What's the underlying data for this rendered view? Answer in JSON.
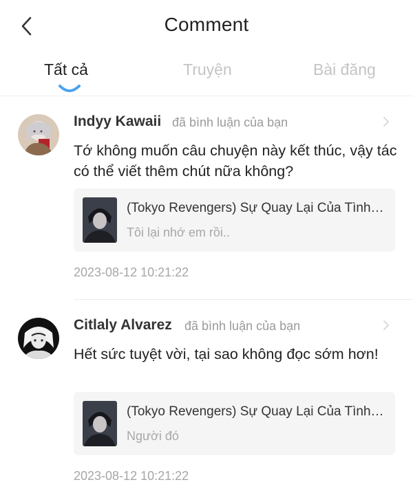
{
  "header": {
    "back_icon": "chevron-left-icon",
    "title": "Comment"
  },
  "tabs": [
    {
      "label": "Tất cả",
      "active": true
    },
    {
      "label": "Truyện",
      "active": false
    },
    {
      "label": "Bài đăng",
      "active": false
    }
  ],
  "comments": [
    {
      "user": "Indyy Kawaii",
      "action": "đã bình luận của bạn",
      "text": "Tớ không muốn câu chuyện này kết thúc, vậy tác có thể viết thêm chút nữa không?",
      "story_title": "(Tokyo Revengers) Sự Quay Lại Của Tình Yêu",
      "story_subtitle": "Tôi lại nhớ em rồi..",
      "time": "2023-08-12 10:21:22"
    },
    {
      "user": "Citlaly Alvarez",
      "action": "đã bình luận của bạn",
      "text": "Hết sức tuyệt vời, tại sao không đọc sớm hơn!",
      "story_title": "(Tokyo Revengers) Sự Quay Lại Của Tình Yêu",
      "story_subtitle": "Người đó",
      "time": "2023-08-12 10:21:22"
    }
  ],
  "colors": {
    "accent": "#4aa3f0",
    "text": "#222222",
    "muted": "#a6a6a6",
    "card_bg": "#f5f5f5"
  }
}
